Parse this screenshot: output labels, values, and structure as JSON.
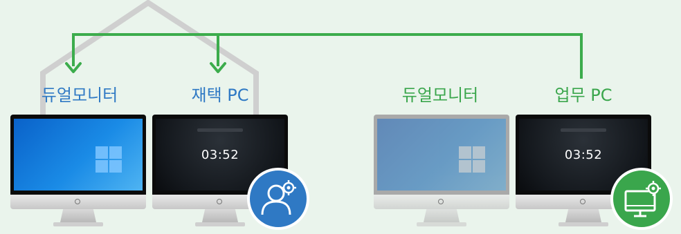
{
  "colors": {
    "background": "#eaf4ec",
    "connector_green": "#3cac4c",
    "connector_gray": "#cfcfcf",
    "label_blue": "#2f79c4",
    "label_green": "#3aa64c",
    "badge_blue": "#2f79c4",
    "badge_green": "#3aa64c"
  },
  "left_group": {
    "monitor_label": "듀얼모니터",
    "pc_label": "재택 PC",
    "clock_time": "03:52",
    "badge_icon": "user-gear-icon"
  },
  "right_group": {
    "monitor_label": "듀얼모니터",
    "pc_label": "업무 PC",
    "clock_time": "03:52",
    "badge_icon": "monitor-gear-icon"
  },
  "icons": {
    "windows_logo": "windows-logo-icon",
    "power": "power-icon",
    "arrow": "arrow-down-icon"
  }
}
